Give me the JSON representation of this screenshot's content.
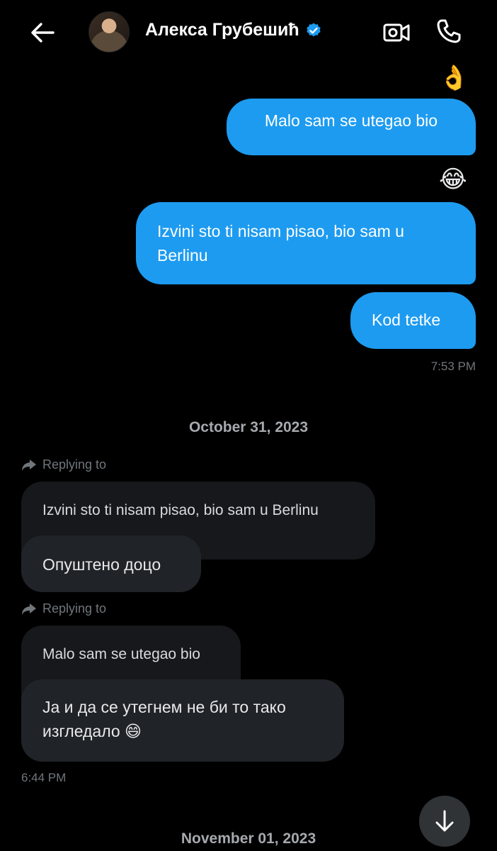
{
  "header": {
    "contact_name": "Алекса Грубешић",
    "verified": true,
    "icons": [
      "back-arrow-icon",
      "verified-badge-icon",
      "video-call-icon",
      "phone-icon"
    ]
  },
  "messages_sent": [
    {
      "reaction": "👌",
      "text": "Malo sam se utegao bio"
    },
    {
      "reaction": "😂",
      "text": "Izvini sto ti nisam pisao, bio sam u Berlinu"
    },
    {
      "text": "Kod tetke",
      "time": "7:53 PM"
    }
  ],
  "date_separators": [
    "October 31, 2023",
    "November 01, 2023"
  ],
  "messages_received": [
    {
      "replying_label": "Replying to",
      "quoted": "Izvini sto ti nisam pisao, bio sam u Berlinu",
      "text": "Опуштено доцо"
    },
    {
      "replying_label": "Replying to",
      "quoted": "Malo sam se utegao bio",
      "text": "Ја и да се утегнем не би то тако изгледало 😄",
      "time": "6:44 PM"
    }
  ],
  "colors": {
    "background": "#000000",
    "outgoing_bubble": "#1d9bf0",
    "incoming_bubble": "#202327",
    "quoted_bubble": "#16181c",
    "muted_text": "#71767b"
  }
}
